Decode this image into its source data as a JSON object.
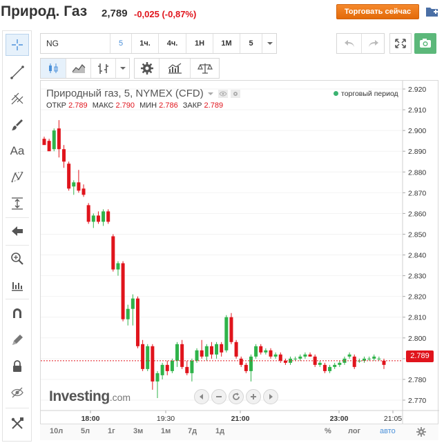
{
  "header": {
    "title": "Природ. Газ",
    "price": "2,789",
    "change": "-0,025 (-0,87%)",
    "trade_button": "Торговать сейчас"
  },
  "toolbar": {
    "symbol": "NG",
    "interval_selected": "5",
    "intervals": [
      "1ч.",
      "4ч.",
      "1Н",
      "1М"
    ],
    "interval_dropdown": "5"
  },
  "legend": {
    "title": "Природный газ, 5, NYMEX (CFD)",
    "open_label": "ОТКР",
    "open_value": "2.789",
    "high_label": "МАКС",
    "high_value": "2.790",
    "low_label": "МИН",
    "low_value": "2.786",
    "close_label": "ЗАКР",
    "close_value": "2.789",
    "session_status": "торговый период"
  },
  "logo": {
    "main": "Investing",
    "suffix": ".com"
  },
  "bottom": {
    "ranges": [
      "10л",
      "5л",
      "1г",
      "3м",
      "1м",
      "7д",
      "1д"
    ],
    "percent": "%",
    "log": "лог",
    "auto": "авто"
  },
  "colors": {
    "up": "#2fb34a",
    "down": "#e0141c",
    "accent": "#4a90d9",
    "trade_button": "#f07a1a"
  },
  "chart_data": {
    "type": "candlestick",
    "y_ticks": [
      "2.920",
      "2.910",
      "2.900",
      "2.890",
      "2.880",
      "2.870",
      "2.860",
      "2.850",
      "2.840",
      "2.830",
      "2.820",
      "2.810",
      "2.800",
      "2.790",
      "2.780",
      "2.770"
    ],
    "x_ticks": [
      "18:00",
      "19:30",
      "21:00",
      "23:00",
      "21:05"
    ],
    "ylim": [
      2.765,
      2.924
    ],
    "last_price": "2.789",
    "last_value": 2.789,
    "candles": [
      [
        2.896,
        2.897,
        2.894,
        2.893
      ],
      [
        2.895,
        2.896,
        2.891,
        2.89
      ],
      [
        2.891,
        2.901,
        2.89,
        2.9
      ],
      [
        2.901,
        2.905,
        2.887,
        2.891
      ],
      [
        2.891,
        2.893,
        2.882,
        2.885
      ],
      [
        2.884,
        2.885,
        2.871,
        2.872
      ],
      [
        2.873,
        2.876,
        2.869,
        2.875
      ],
      [
        2.875,
        2.881,
        2.87,
        2.871
      ],
      [
        2.872,
        2.874,
        2.868,
        2.869
      ],
      [
        2.864,
        2.865,
        2.855,
        2.856
      ],
      [
        2.856,
        2.86,
        2.853,
        2.859
      ],
      [
        2.859,
        2.861,
        2.855,
        2.856
      ],
      [
        2.856,
        2.862,
        2.854,
        2.861
      ],
      [
        2.861,
        2.862,
        2.855,
        2.856
      ],
      [
        2.849,
        2.85,
        2.832,
        2.833
      ],
      [
        2.833,
        2.837,
        2.83,
        2.836
      ],
      [
        2.836,
        2.837,
        2.808,
        2.809
      ],
      [
        2.809,
        2.816,
        2.806,
        2.814
      ],
      [
        2.814,
        2.821,
        2.806,
        2.819
      ],
      [
        2.819,
        2.82,
        2.795,
        2.796
      ],
      [
        2.797,
        2.799,
        2.784,
        2.785
      ],
      [
        2.785,
        2.797,
        2.784,
        2.796
      ],
      [
        2.796,
        2.797,
        2.775,
        2.779
      ],
      [
        2.779,
        2.784,
        2.771,
        2.783
      ],
      [
        2.782,
        2.788,
        2.78,
        2.787
      ],
      [
        2.787,
        2.789,
        2.782,
        2.784
      ],
      [
        2.784,
        2.79,
        2.783,
        2.789
      ],
      [
        2.789,
        2.798,
        2.786,
        2.797
      ],
      [
        2.797,
        2.799,
        2.785,
        2.786
      ],
      [
        2.786,
        2.789,
        2.782,
        2.783
      ],
      [
        2.783,
        2.79,
        2.779,
        2.789
      ],
      [
        2.789,
        2.795,
        2.788,
        2.794
      ],
      [
        2.794,
        2.799,
        2.79,
        2.791
      ],
      [
        2.791,
        2.797,
        2.789,
        2.796
      ],
      [
        2.796,
        2.798,
        2.79,
        2.792
      ],
      [
        2.792,
        2.798,
        2.79,
        2.797
      ],
      [
        2.797,
        2.798,
        2.791,
        2.793
      ],
      [
        2.794,
        2.811,
        2.793,
        2.81
      ],
      [
        2.81,
        2.812,
        2.797,
        2.798
      ],
      [
        2.798,
        2.799,
        2.79,
        2.791
      ],
      [
        2.79,
        2.791,
        2.786,
        2.787
      ],
      [
        2.787,
        2.788,
        2.783,
        2.784
      ],
      [
        2.784,
        2.792,
        2.779,
        2.791
      ],
      [
        2.791,
        2.797,
        2.79,
        2.796
      ],
      [
        2.796,
        2.797,
        2.792,
        2.793
      ],
      [
        2.793,
        2.795,
        2.792,
        2.794
      ],
      [
        2.794,
        2.795,
        2.79,
        2.791
      ],
      [
        2.791,
        2.793,
        2.79,
        2.792
      ],
      [
        2.792,
        2.793,
        2.788,
        2.789
      ],
      [
        2.789,
        2.79,
        2.787,
        2.788
      ],
      [
        2.788,
        2.791,
        2.787,
        2.79
      ],
      [
        2.79,
        2.791,
        2.789,
        2.79
      ],
      [
        2.79,
        2.792,
        2.789,
        2.791
      ],
      [
        2.791,
        2.793,
        2.79,
        2.792
      ],
      [
        2.792,
        2.793,
        2.791,
        2.791
      ],
      [
        2.791,
        2.792,
        2.786,
        2.787
      ],
      [
        2.787,
        2.789,
        2.786,
        2.788
      ],
      [
        2.787,
        2.788,
        2.783,
        2.784
      ],
      [
        2.784,
        2.787,
        2.783,
        2.786
      ],
      [
        2.786,
        2.788,
        2.785,
        2.787
      ],
      [
        2.787,
        2.789,
        2.786,
        2.788
      ],
      [
        2.788,
        2.791,
        2.787,
        2.79
      ],
      [
        2.791,
        2.793,
        2.79,
        2.792
      ],
      [
        2.791,
        2.792,
        2.785,
        2.786
      ],
      [
        2.789,
        2.79,
        2.788,
        2.789
      ],
      [
        2.789,
        2.791,
        2.788,
        2.79
      ],
      [
        2.79,
        2.791,
        2.789,
        2.79
      ],
      [
        2.79,
        2.792,
        2.789,
        2.791
      ],
      [
        2.79,
        2.791,
        2.789,
        2.79
      ],
      [
        2.789,
        2.79,
        2.785,
        2.787
      ]
    ]
  }
}
